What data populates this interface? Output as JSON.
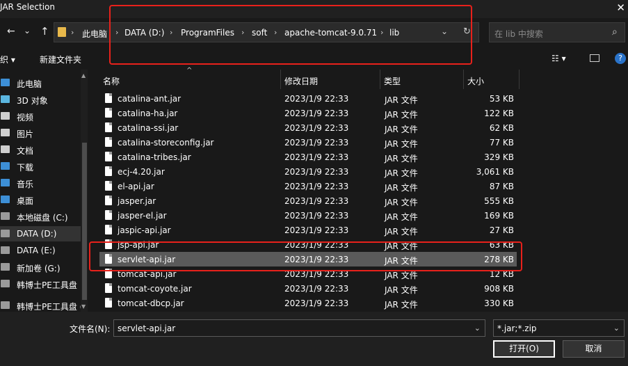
{
  "window": {
    "title": "JAR Selection",
    "close_glyph": "✕"
  },
  "nav": {
    "back": "←",
    "forward": "→",
    "dropdown": "⌄",
    "up": "↑"
  },
  "address": {
    "crumbs": [
      "此电脑",
      "DATA (D:)",
      "ProgramFiles",
      "soft",
      "apache-tomcat-9.0.71",
      "lib"
    ],
    "separator": "›",
    "refresh": "↻",
    "dropdown": "⌄"
  },
  "search": {
    "placeholder": "在 lib 中搜索",
    "icon": "⌕"
  },
  "toolbar": {
    "organize": "织 ▾",
    "new_folder": "新建文件夹",
    "view": "☷ ▾",
    "help": "?"
  },
  "sidebar": {
    "items": [
      {
        "label": "此电脑",
        "icon": "computer-icon",
        "color": "#3d8fd6"
      },
      {
        "label": "3D 对象",
        "icon": "cube-icon",
        "color": "#5bb6e0"
      },
      {
        "label": "视频",
        "icon": "video-icon",
        "color": "#cfcfcf"
      },
      {
        "label": "图片",
        "icon": "picture-icon",
        "color": "#cfcfcf"
      },
      {
        "label": "文档",
        "icon": "document-icon",
        "color": "#cfcfcf"
      },
      {
        "label": "下载",
        "icon": "download-icon",
        "color": "#3d8fd6"
      },
      {
        "label": "音乐",
        "icon": "music-icon",
        "color": "#3d8fd6"
      },
      {
        "label": "桌面",
        "icon": "desktop-icon",
        "color": "#3d8fd6"
      },
      {
        "label": "本地磁盘 (C:)",
        "icon": "drive-icon",
        "color": "#9a9a9a"
      },
      {
        "label": "DATA (D:)",
        "icon": "drive-icon",
        "color": "#9a9a9a"
      },
      {
        "label": "DATA (E:)",
        "icon": "drive-icon",
        "color": "#9a9a9a"
      },
      {
        "label": "新加卷 (G:)",
        "icon": "drive-icon",
        "color": "#9a9a9a"
      },
      {
        "label": "韩博士PE工具盘",
        "icon": "drive-icon",
        "color": "#9a9a9a"
      },
      {
        "label": "韩博士PE工具盘 (",
        "icon": "drive-icon",
        "color": "#9a9a9a"
      }
    ],
    "selected_index": 9
  },
  "columns": {
    "name": "名称",
    "modified": "修改日期",
    "type": "类型",
    "size": "大小",
    "sort_indicator": "^"
  },
  "files": [
    {
      "name": "catalina-ant.jar",
      "modified": "2023/1/9 22:33",
      "type": "JAR 文件",
      "size": "53 KB"
    },
    {
      "name": "catalina-ha.jar",
      "modified": "2023/1/9 22:33",
      "type": "JAR 文件",
      "size": "122 KB"
    },
    {
      "name": "catalina-ssi.jar",
      "modified": "2023/1/9 22:33",
      "type": "JAR 文件",
      "size": "62 KB"
    },
    {
      "name": "catalina-storeconfig.jar",
      "modified": "2023/1/9 22:33",
      "type": "JAR 文件",
      "size": "77 KB"
    },
    {
      "name": "catalina-tribes.jar",
      "modified": "2023/1/9 22:33",
      "type": "JAR 文件",
      "size": "329 KB"
    },
    {
      "name": "ecj-4.20.jar",
      "modified": "2023/1/9 22:33",
      "type": "JAR 文件",
      "size": "3,061 KB"
    },
    {
      "name": "el-api.jar",
      "modified": "2023/1/9 22:33",
      "type": "JAR 文件",
      "size": "87 KB"
    },
    {
      "name": "jasper.jar",
      "modified": "2023/1/9 22:33",
      "type": "JAR 文件",
      "size": "555 KB"
    },
    {
      "name": "jasper-el.jar",
      "modified": "2023/1/9 22:33",
      "type": "JAR 文件",
      "size": "169 KB"
    },
    {
      "name": "jaspic-api.jar",
      "modified": "2023/1/9 22:33",
      "type": "JAR 文件",
      "size": "27 KB"
    },
    {
      "name": "jsp-api.jar",
      "modified": "2023/1/9 22:33",
      "type": "JAR 文件",
      "size": "63 KB"
    },
    {
      "name": "servlet-api.jar",
      "modified": "2023/1/9 22:33",
      "type": "JAR 文件",
      "size": "278 KB"
    },
    {
      "name": "tomcat-api.jar",
      "modified": "2023/1/9 22:33",
      "type": "JAR 文件",
      "size": "12 KB"
    },
    {
      "name": "tomcat-coyote.jar",
      "modified": "2023/1/9 22:33",
      "type": "JAR 文件",
      "size": "908 KB"
    },
    {
      "name": "tomcat-dbcp.jar",
      "modified": "2023/1/9 22:33",
      "type": "JAR 文件",
      "size": "330 KB"
    }
  ],
  "selected_file_index": 11,
  "footer": {
    "filename_label": "文件名(N):",
    "filename_value": "servlet-api.jar",
    "filter_value": "*.jar;*.zip",
    "open_label": "打开(O)",
    "cancel_label": "取消"
  },
  "colors": {
    "annotation_red": "#e8211b",
    "selection": "#5a5a5a",
    "background": "#191919"
  }
}
